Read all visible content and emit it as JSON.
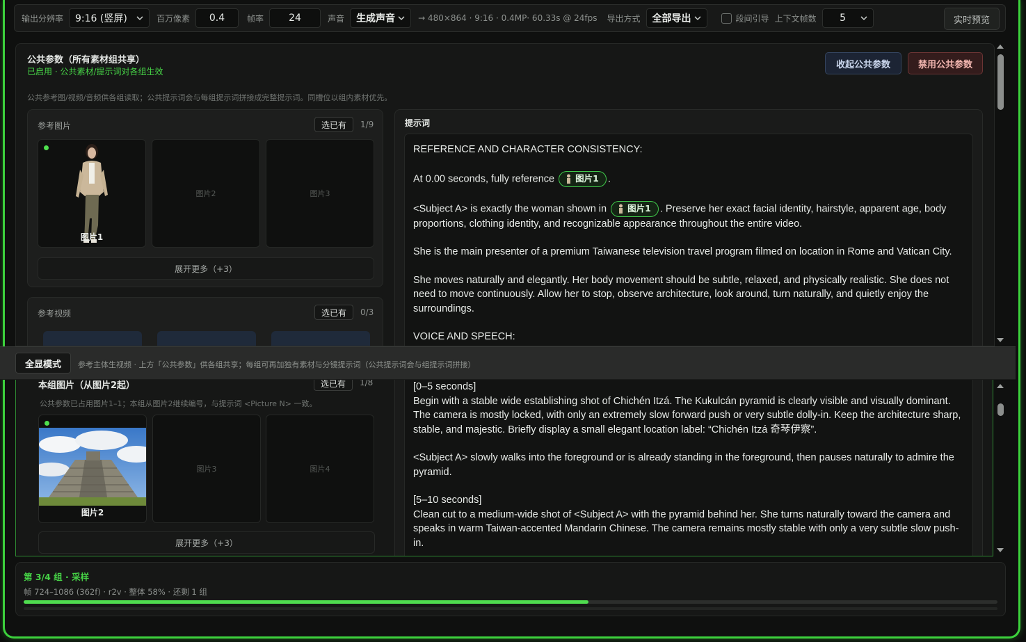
{
  "toolbar": {
    "resolution_label": "输出分辨率",
    "resolution_value": "9:16 (竖屏)",
    "megapixel_label": "百万像素",
    "megapixel_value": "0.4",
    "fps_label": "帧率",
    "fps_value": "24",
    "audio_label": "声音",
    "audio_value": "生成声音",
    "output_info": "→ 480×864 · 9:16 · 0.4MP· 60.33s @ 24fps",
    "export_label": "导出方式",
    "export_value": "全部导出",
    "segment_guide_label": "段间引导",
    "context_frames_label": "上下文帧数",
    "context_frames_value": "5",
    "preview_button": "实时预览"
  },
  "shared": {
    "title": "公共参数（所有素材组共享）",
    "status": "已启用 · 公共素材/提示词对各组生效",
    "description": "公共参考图/视频/音频供各组读取；公共提示词会与每组提示词拼接成完整提示词。同槽位以组内素材优先。",
    "collapse_button": "收起公共参数",
    "disable_button": "禁用公共参数",
    "ref_images": {
      "title": "参考图片",
      "selected_label": "选已有",
      "count": "1/9",
      "slots": [
        "图片1",
        "图片2",
        "图片3"
      ],
      "expand": "展开更多（+3）"
    },
    "ref_videos": {
      "title": "参考视频",
      "selected_label": "选已有",
      "count": "0/3"
    },
    "prompt": {
      "label": "提示词",
      "chip": "图片1",
      "p1": "REFERENCE AND CHARACTER CONSISTENCY:",
      "p2_before": "At 0.00 seconds, fully reference",
      "p2_after": ".",
      "p3_before": "<Subject A> is exactly the woman shown in",
      "p3_after": ". Preserve her exact facial identity, hairstyle, apparent age, body proportions, clothing identity, and recognizable appearance throughout the entire video.",
      "p4": "She is the main presenter of a premium Taiwanese television travel program filmed on location in Rome and Vatican City.",
      "p5": "She moves naturally and elegantly. Her body movement should be subtle, relaxed, and physically realistic. She does not need to move continuously. Allow her to stop, observe architecture, look around, turn naturally, and quietly enjoy the surroundings.",
      "p6": "VOICE AND SPEECH:"
    }
  },
  "mode": {
    "button": "全显模式",
    "description": "参考主体生视频 · 上方「公共参数」供各组共享；每组可再加独有素材与分镜提示词（公共提示词会与组提示词拼接）"
  },
  "group": {
    "title": "本组图片（从图片2起）",
    "selected_label": "选已有",
    "count": "1/8",
    "subtitle": "公共参数已占用图片1–1；本组从图片2继续编号，与提示词 <Picture N> 一致。",
    "slots": [
      "图片2",
      "图片3",
      "图片4"
    ],
    "expand": "展开更多（+3）",
    "prompt": {
      "p1a": "[0–5 seconds]",
      "p1b": "Begin with a stable wide establishing shot of Chichén Itzá. The Kukulcán pyramid is clearly visible and visually dominant. The camera is mostly locked, with only an extremely slow forward push or very subtle dolly-in. Keep the architecture sharp, stable, and majestic. Briefly display a small elegant location label: “Chichén Itzá 奇琴伊察”.",
      "p2": "<Subject A> slowly walks into the foreground or is already standing in the foreground, then pauses naturally to admire the pyramid.",
      "p3a": "[5–10 seconds]",
      "p3b": "Clean cut to a medium-wide shot of <Subject A> with the pyramid behind her. She turns naturally toward the camera and speaks in warm Taiwan-accented Mandarin Chinese. The camera remains mostly stable with only a very subtle slow push-in."
    }
  },
  "status": {
    "title": "第 3/4 组 · 采样",
    "meta": "帧 724–1086 (362f) · r2v · 整体 58% · 还剩 1 组",
    "progress": 0.58
  },
  "colors": {
    "accent_green": "#46d246",
    "frame_green": "#3cd13c"
  }
}
